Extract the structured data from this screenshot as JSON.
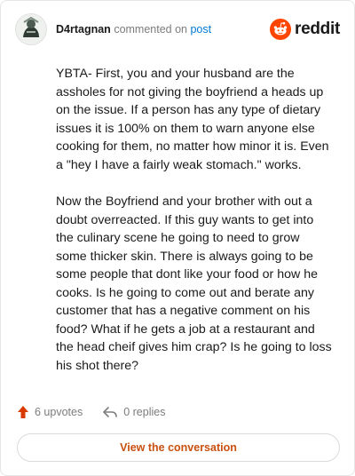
{
  "comment": {
    "username": "D4rtagnan",
    "verb": "commented on",
    "post_link": "post",
    "paragraphs": [
      "YBTA- First, you and your husband are the assholes for not giving the boyfriend a heads up on the issue. If a person has any type of dietary issues it is 100% on them to warn anyone else cooking for them, no matter how minor it is. Even a \"hey I have a fairly weak stomach.\" works.",
      "Now the Boyfriend and your brother with out a doubt overreacted. If this guy wants to get into the culinary scene he going to need to grow some thicker skin. There is always going to be some people that dont like your food or how he cooks. Is he going to come out and berate any customer that has a negative comment on his food? What if he gets a job at a restaurant and the head cheif gives him crap? Is he going to loss his shot there?"
    ]
  },
  "brand": {
    "wordmark": "reddit",
    "logo_icon": "reddit-snoo-icon",
    "accent": "#ff4500"
  },
  "stats": {
    "upvotes": "6 upvotes",
    "upvote_icon": "upvote-arrow-icon",
    "upvote_color": "#d93a00",
    "replies": "0 replies",
    "reply_icon": "reply-arrow-icon"
  },
  "cta": {
    "label": "View the conversation",
    "color": "#c8500f"
  }
}
